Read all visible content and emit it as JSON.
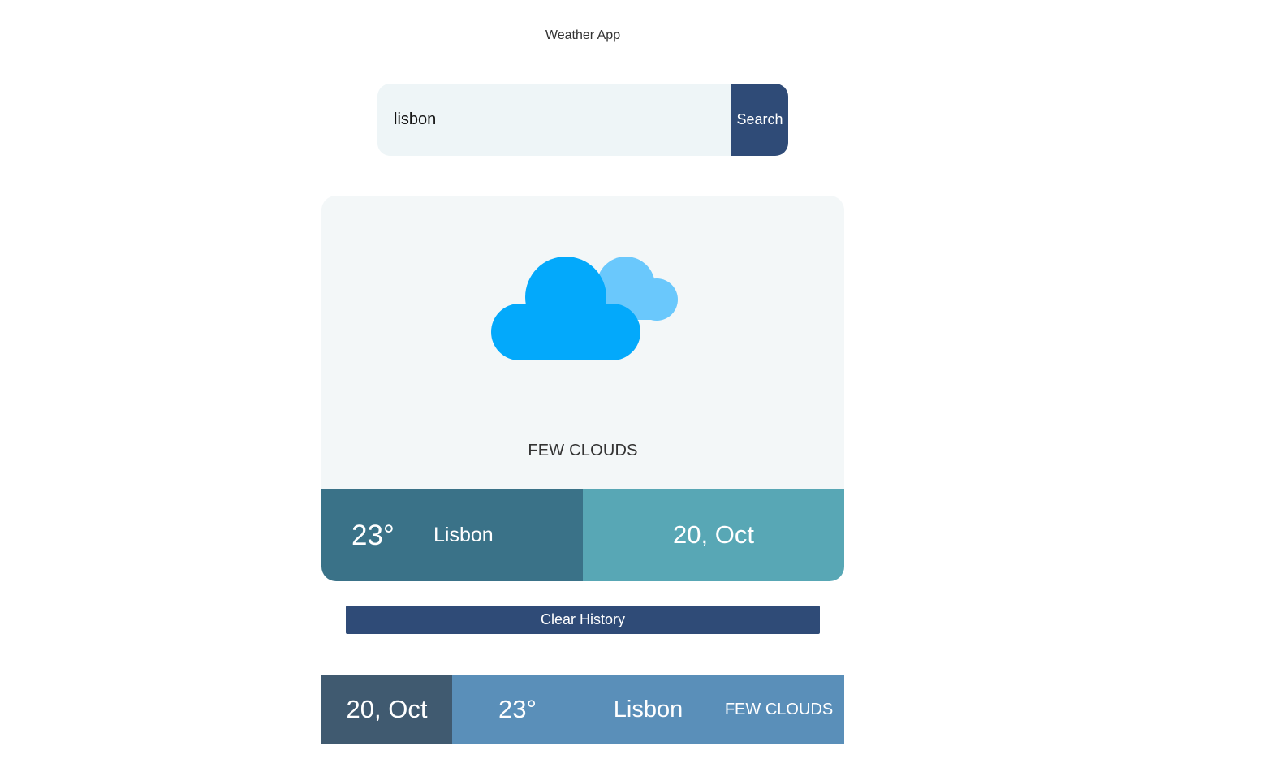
{
  "app": {
    "title": "Weather App"
  },
  "search": {
    "value": "lisbon",
    "button_label": "Search"
  },
  "current": {
    "icon": "few-clouds-icon",
    "condition": "FEW CLOUDS",
    "temperature": "23°",
    "city": "Lisbon",
    "date": "20, Oct"
  },
  "history": {
    "clear_label": "Clear History",
    "items": [
      {
        "date": "20, Oct",
        "temperature": "23°",
        "city": "Lisbon",
        "condition": "FEW CLOUDS"
      }
    ]
  },
  "colors": {
    "primary": "#2f4b77",
    "card_bg": "#f3f7f8",
    "footer_left": "#3a7288",
    "footer_right": "#58a7b5",
    "history_date": "#405a70",
    "history_rest": "#5a8fb9",
    "cloud_front": "#03a9fb",
    "cloud_back": "#6ac8fc"
  }
}
